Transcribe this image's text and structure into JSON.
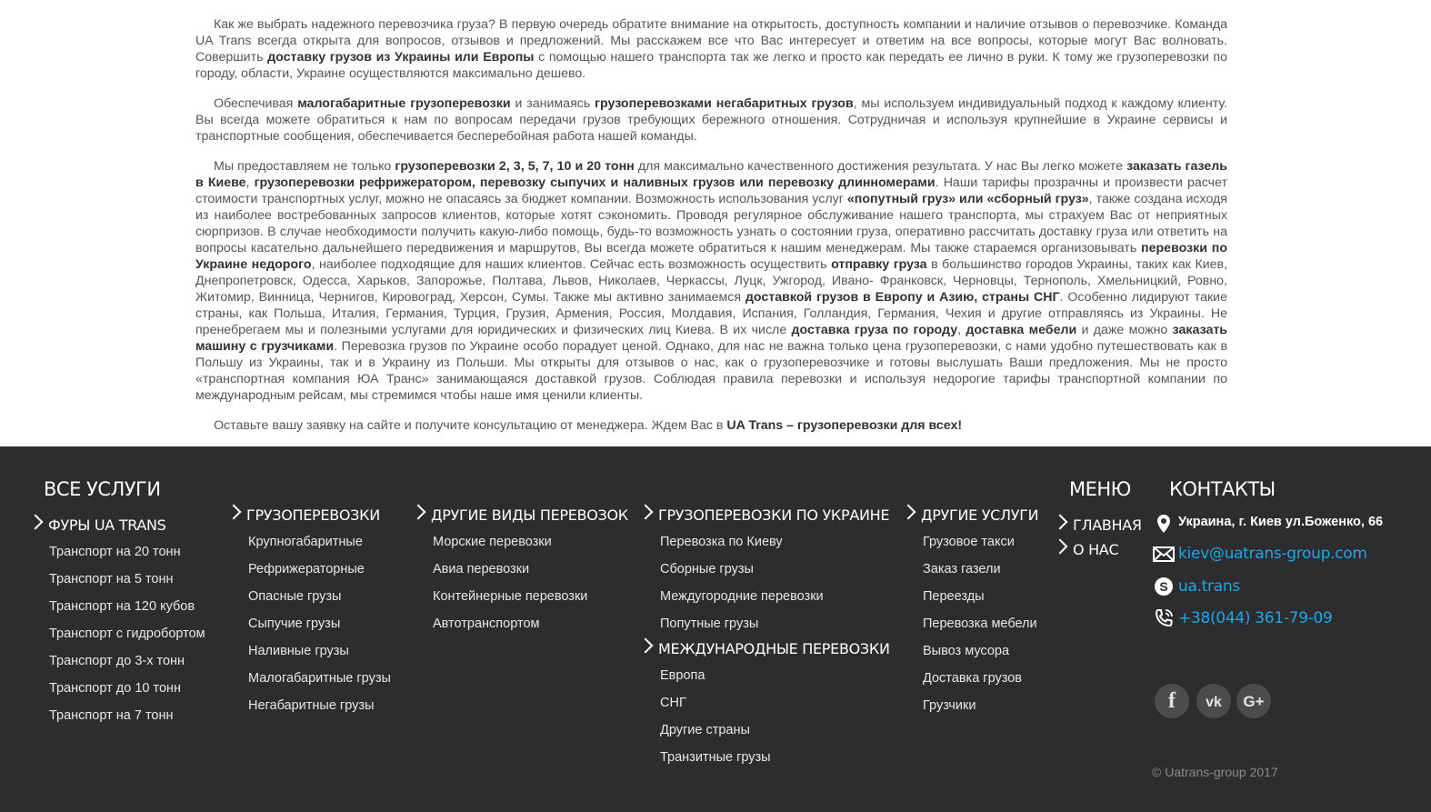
{
  "article": {
    "p1": {
      "a": "Как же выбрать надежного перевозчика груза? В первую очередь обратите внимание на открытость, доступность компании и наличие отзывов о перевозчике. Команда UA Trans всегда открыта для вопросов, отзывов и предложений. Мы расскажем все что Вас интересует и ответим на все вопросы, которые могут Вас волновать. Совершить ",
      "b": "доставку грузов из Украины или Европы",
      "c": " с помощью нашего транспорта так же легко и просто как передать ее лично в руки. К тому же грузоперевозки по городу, области, Украине осуществляются максимально дешево."
    },
    "p2": {
      "a": "Обеспечивая ",
      "b": "малогабаритные грузоперевозки",
      "c": " и занимаясь ",
      "d": "грузоперевозками негабаритных грузов",
      "e": ", мы используем индивидуальный подход к каждому клиенту. Вы всегда можете обратиться к нам по вопросам передачи грузов требующих бережного отношения. Сотрудничая и используя крупнейшие в Украине сервисы и транспортные сообщения, обеспечивается бесперебойная работа нашей команды."
    },
    "p3": {
      "t1": "Мы предоставляем не только ",
      "b1": "грузоперевозки 2, 3, 5, 7, 10 и 20 тонн",
      "t2": " для максимально качественного достижения результата. У нас Вы легко можете ",
      "b2": "заказать газель в Киеве",
      "t3": ", ",
      "b3": "грузоперевозки рефрижератором, перевозку сыпучих и наливных грузов или перевозку длинномерами",
      "t4": ". Наши тарифы прозрачны и произвести расчет стоимости транспортных услуг, можно не опасаясь за бюджет компании. Возможность использования услуг ",
      "b4": "«попутный груз» или «сборный груз»",
      "t5": ", также создана исходя из наиболее востребованных запросов клиентов, которые хотят сэкономить. Проводя регулярное обслуживание нашего транспорта, мы страхуем Вас от неприятных сюрпризов. В случае необходимости получить какую-либо помощь, будь-то возможность узнать о состоянии груза, оперативно рассчитать доставку груза или ответить на вопросы касательно дальнейшего передвижения и маршрутов, Вы всегда можете обратиться к нашим менеджерам. Мы также стараемся организовывать ",
      "b5": "перевозки по Украине недорого",
      "t6": ", наиболее подходящие для наших клиентов. Сейчас есть возможность осуществить ",
      "b6": "отправку груза",
      "t7": " в большинство городов Украины, таких как Киев, Днепропетровск, Одесса, Харьков, Запорожье, Полтава, Львов, Николаев, Черкассы, Луцк, Ужгород, Ивано- Франковск, Черновцы, Тернополь, Хмельницкий, Ровно, Житомир, Винница, Чернигов, Кировоград, Херсон, Сумы. Также мы активно занимаемся ",
      "b7": "доставкой грузов в Европу и Азию, страны СНГ",
      "t8": ". Особенно лидируют такие страны, как Польша, Италия, Германия, Турция, Грузия, Армения, Россия, Молдавия, Испания, Голландия, Германия, Чехия и другие отправляясь из Украины. Не пренебрегаем мы и полезными услугами для юридических и физических лиц Киева. В их числе ",
      "b8": "доставка груза по городу",
      "t9": ", ",
      "b9": "доставка мебели",
      "t10": " и даже можно ",
      "b10": "заказать машину с грузчиками",
      "t11": ". Перевозка грузов по Украине особо порадует ценой. Однако, для нас не важна только цена грузоперевозки, с нами удобно путешествовать как в Польшу из Украины, так и в Украину из Польши. Мы открыты для отзывов о нас, как о грузоперевозчике и готовы выслушать Ваши предложения. Мы не просто «транспортная компания ЮА Транс» занимающаяся доставкой грузов. Соблюдая правила перевозки и используя недорогие тарифы транспортной компании по международным рейсам, мы стремимся чтобы наше имя ценили клиенты."
    },
    "p4": {
      "a": "Оставьте вашу заявку на сайте и получите консультацию от менеджера. Ждем Вас в ",
      "b": "UA Trans – грузоперевозки для всех!"
    }
  },
  "footer": {
    "all_services": {
      "title": "ВСЕ УСЛУГИ",
      "fury_title": "ФУРЫ UA TRANS",
      "fury_items": [
        "Транспорт на 20 тонн",
        "Транспорт на 5 тонн",
        "Транспорт на 120 кубов",
        "Транспорт с гидробортом",
        "Транспорт до 3-х тонн",
        "Транспорт до 10 тонн",
        "Транспорт на 7 тонн"
      ],
      "cargo_title": "ГРУЗОПЕРЕВОЗКИ",
      "cargo_items": [
        "Крупногабаритные",
        "Рефрижераторные",
        "Опасные грузы",
        "Сыпучие грузы",
        "Наливные грузы",
        "Малогабаритные грузы",
        "Негабаритные грузы"
      ],
      "other_transport_title": "ДРУГИЕ ВИДЫ ПЕРЕВОЗОК",
      "other_transport_items": [
        "Морские перевозки",
        "Авиа перевозки",
        "Контейнерные перевозки",
        "Автотранспортом"
      ],
      "ukraine_title": "ГРУЗОПЕРЕВОЗКИ ПО УКРАИНЕ",
      "ukraine_items": [
        "Перевозка по Киеву",
        "Сборные грузы",
        "Междугородние перевозки",
        "Попутные грузы"
      ],
      "intl_title": "МЕЖДУНАРОДНЫЕ ПЕРЕВОЗКИ",
      "intl_items": [
        "Европа",
        "СНГ",
        "Другие страны",
        "Транзитные грузы"
      ],
      "other_services_title": "ДРУГИЕ УСЛУГИ",
      "other_services_items": [
        "Грузовое такси",
        "Заказ газели",
        "Переезды",
        "Перевозка мебели",
        "Вывоз мусора",
        "Доставка грузов",
        "Грузчики"
      ]
    },
    "menu": {
      "title": "МЕНЮ",
      "items": [
        "ГЛАВНАЯ",
        "О НАС"
      ]
    },
    "contacts": {
      "title": "КОНТАКТЫ",
      "address": "Украина, г. Киев ул.Боженко, 66",
      "email": "kiev@uatrans-group.com",
      "skype": "ua.trans",
      "phone": "+38(044) 361-79-09",
      "social": {
        "facebook": "f",
        "vk": "vk",
        "gplus": "G+"
      },
      "icons": [
        "map-pin-icon",
        "mail-icon",
        "skype-icon",
        "phone-icon"
      ]
    },
    "copyright": "© Uatrans-group 2017"
  },
  "colors": {
    "footer_bg": "#2d2d2f",
    "link": "#1aa7ec",
    "text": "#555555"
  }
}
